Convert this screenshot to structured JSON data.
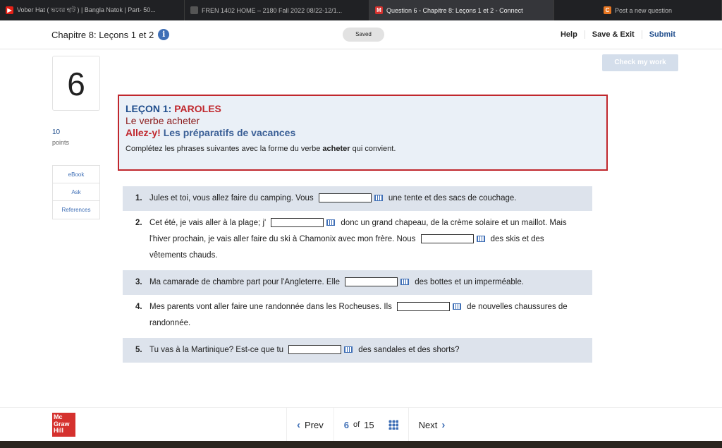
{
  "tabs": [
    {
      "label": "Vober Hat ( ভবের হাট ) | Bangla Natok | Part- 50...",
      "icon": "youtube-icon",
      "color": "#e62117"
    },
    {
      "label": "FREN 1402 HOME – 2180 Fall 2022 08/22-12/1...",
      "icon": "course-icon",
      "color": "#555"
    },
    {
      "label": "Question 6 - Chapitre 8: Leçons 1 et 2 - Connect",
      "icon": "mcgraw-m-icon",
      "color": "#d5312e",
      "active": true
    },
    {
      "label": "Post a new question",
      "icon": "chegg-c-icon",
      "color": "#e87722"
    }
  ],
  "header": {
    "title": "Chapitre 8: Leçons 1 et 2",
    "saved": "Saved",
    "help": "Help",
    "save_exit": "Save & Exit",
    "submit": "Submit"
  },
  "question": {
    "number": "6",
    "points": "10",
    "points_label": "points",
    "check_label": "Check my work"
  },
  "side": [
    "eBook",
    "Ask",
    "References"
  ],
  "instructions": {
    "lecon": "LEÇON 1:",
    "paroles": "PAROLES",
    "verbe": "Le verbe acheter",
    "allez": "Allez-y!",
    "titre": "Les préparatifs de vacances",
    "text_pre": "Complétez les phrases suivantes avec la forme du verbe ",
    "text_bold": "acheter",
    "text_post": " qui convient."
  },
  "items": [
    {
      "n": "1.",
      "parts": [
        "Jules et toi, vous allez faire du camping. Vous",
        "une tente et des sacs de couchage."
      ]
    },
    {
      "n": "2.",
      "parts": [
        "Cet été, je vais aller à la plage; j'",
        "donc un grand chapeau, de la crème solaire et un maillot. Mais l'hiver prochain, je vais aller faire du ski à Chamonix avec mon frère. Nous",
        "des skis et des vêtements chauds."
      ]
    },
    {
      "n": "3.",
      "parts": [
        "Ma camarade de chambre part pour l'Angleterre. Elle",
        "des bottes et un imperméable."
      ]
    },
    {
      "n": "4.",
      "parts": [
        "Mes parents vont aller faire une randonnée dans les Rocheuses. Ils",
        "de nouvelles chaussures de randonnée."
      ]
    },
    {
      "n": "5.",
      "parts": [
        "Tu vas à la Martinique? Est-ce que tu",
        "des sandales et des shorts?"
      ]
    }
  ],
  "footer": {
    "logo": "Mc Graw Hill",
    "prev": "Prev",
    "current": "6",
    "of": "of",
    "total": "15",
    "next": "Next"
  },
  "colors": {
    "accent": "#3f6fb6",
    "red": "#c0272d"
  }
}
